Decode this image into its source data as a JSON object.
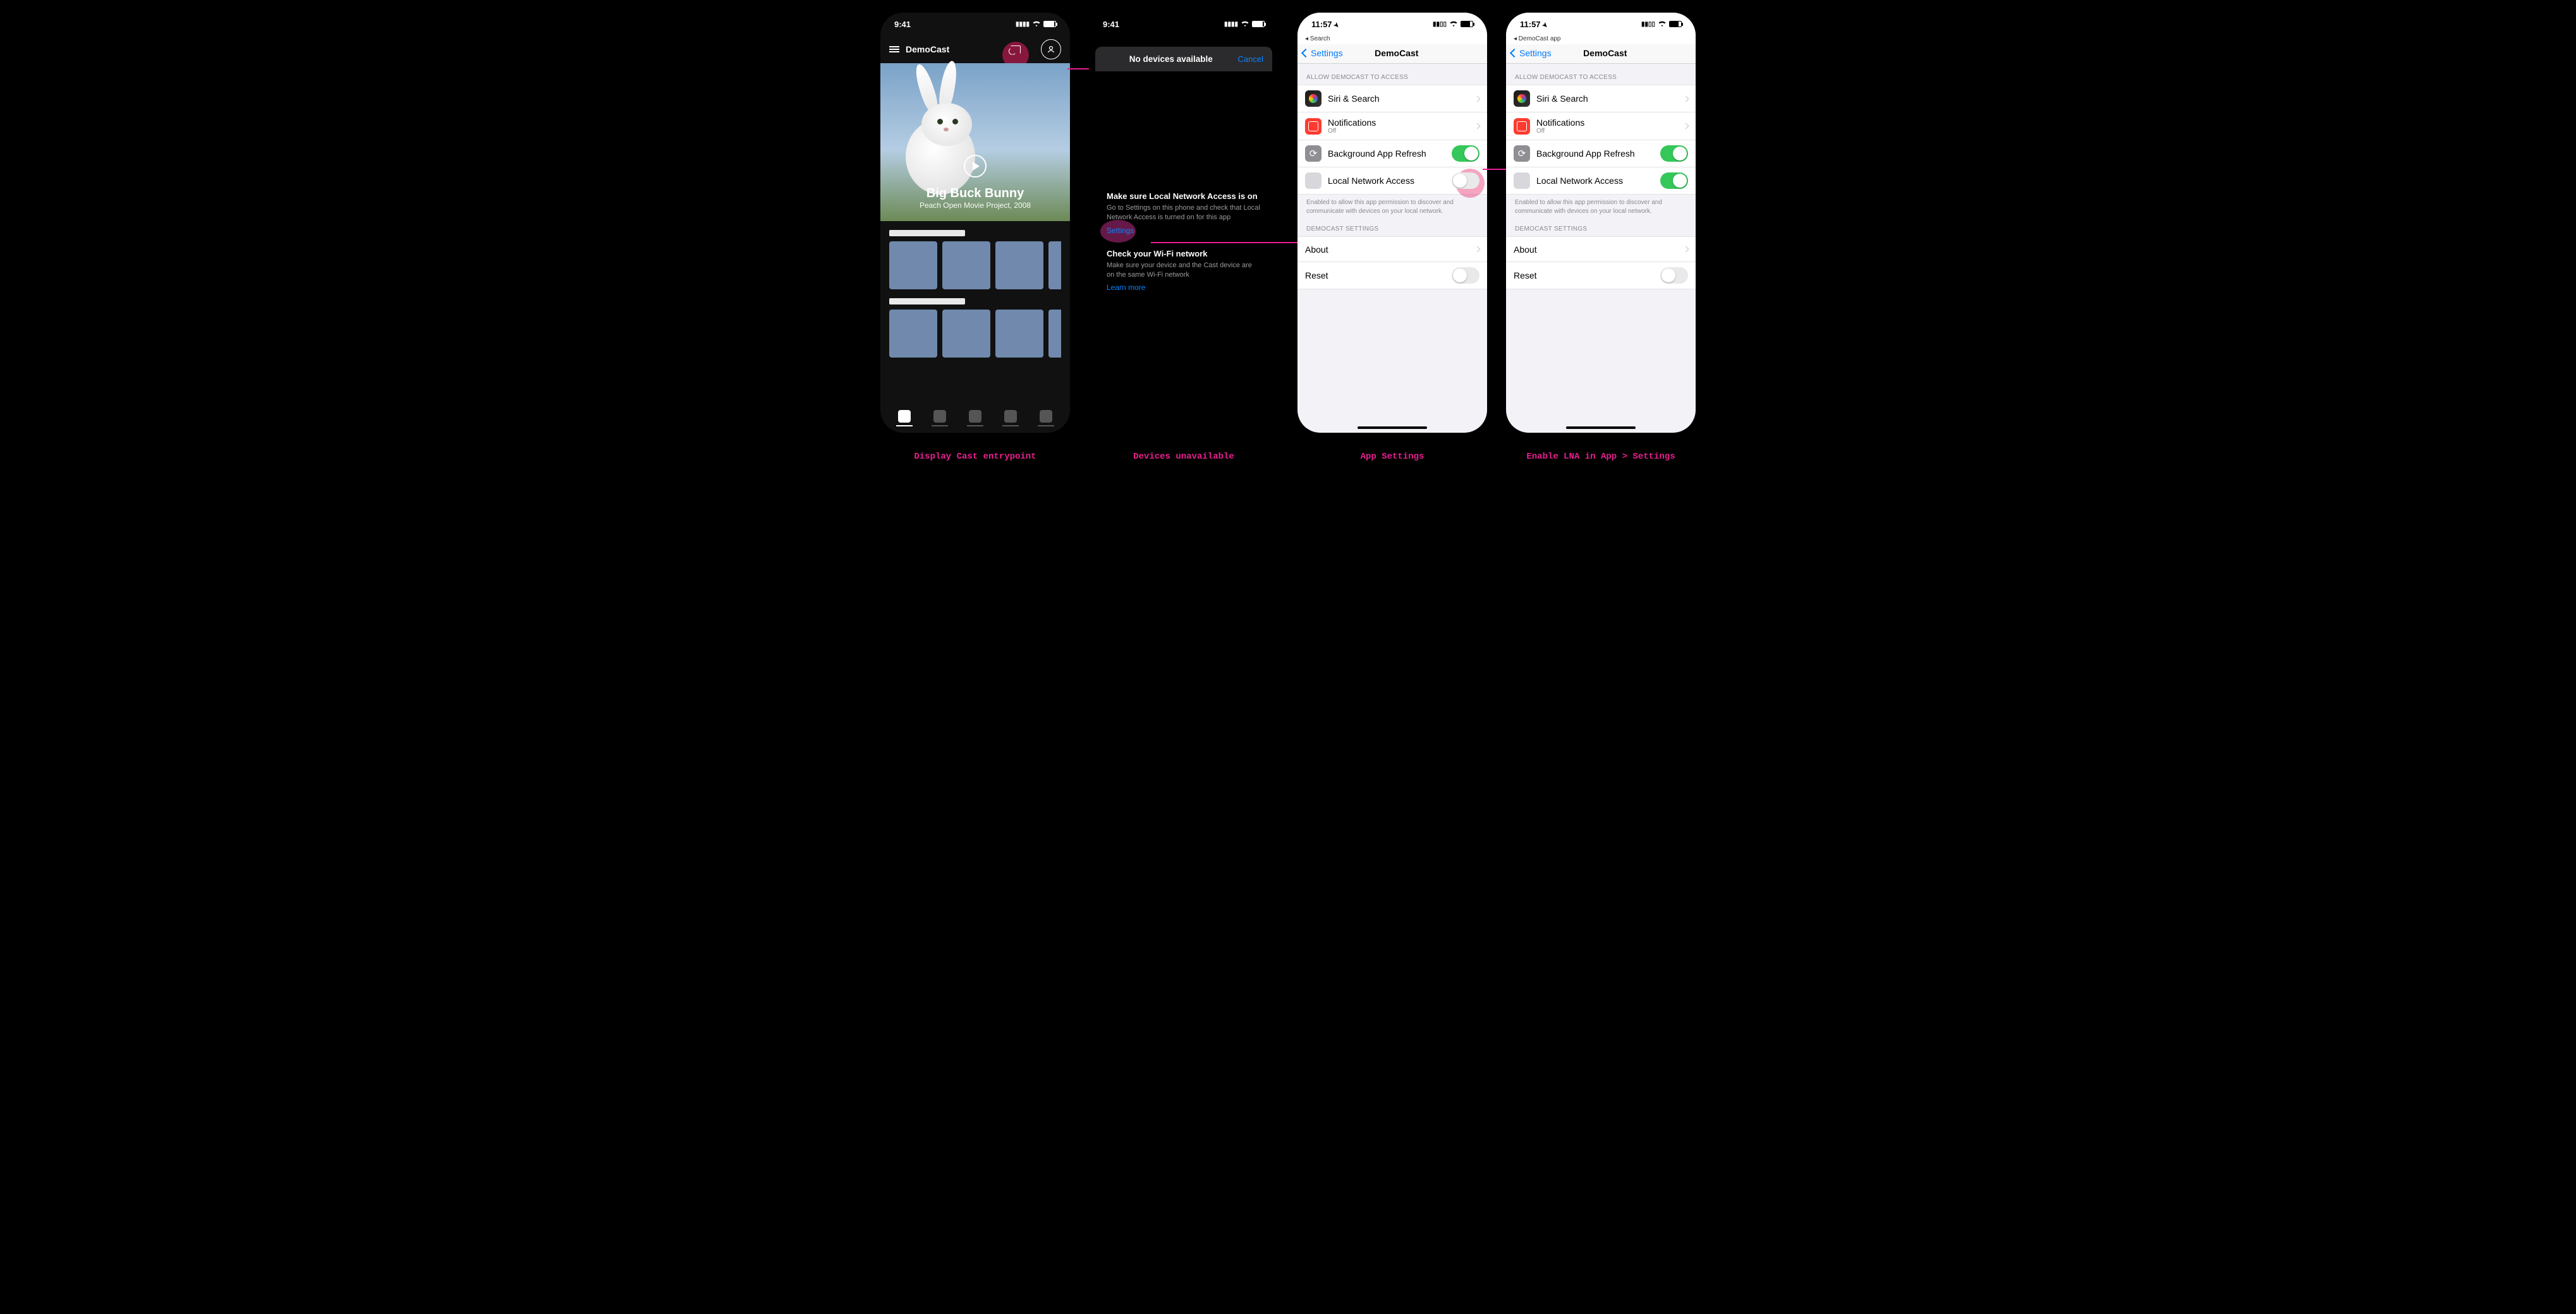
{
  "captions": {
    "c1": "Display Cast entrypoint",
    "c2": "Devices unavailable",
    "c3": "App Settings",
    "c4": "Enable LNA in App > Settings"
  },
  "phone1": {
    "time": "9:41",
    "app_name": "DemoCast",
    "hero_title": "Big Buck Bunny",
    "hero_subtitle": "Peach Open Movie Project, 2008"
  },
  "phone2": {
    "time": "9:41",
    "sheet_title": "No devices available",
    "cancel": "Cancel",
    "tip1_title": "Make sure Local Network Access is on",
    "tip1_desc": "Go to Settings on this phone and check that Local Network Access is turned on for this app",
    "settings_link": "Settings",
    "tip2_title": "Check your Wi-Fi network",
    "tip2_desc": "Make sure your device and the Cast device are on the same Wi-Fi network",
    "learn_more": "Learn more"
  },
  "settings_common": {
    "time": "11:57",
    "back": "Settings",
    "title": "DemoCast",
    "section_access": "ALLOW DEMOCAST TO ACCESS",
    "siri": "Siri & Search",
    "notifications": "Notifications",
    "notifications_sub": "Off",
    "background": "Background App Refresh",
    "lna": "Local Network Access",
    "lna_note": "Enabled to allow this app permission to discover and communicate with devices on your local network.",
    "section_app": "DEMOCAST SETTINGS",
    "about": "About",
    "reset": "Reset"
  },
  "phone3": {
    "breadcrumb": "◂ Search",
    "lna_on": false
  },
  "phone4": {
    "breadcrumb": "◂ DemoCast app",
    "lna_on": true
  }
}
